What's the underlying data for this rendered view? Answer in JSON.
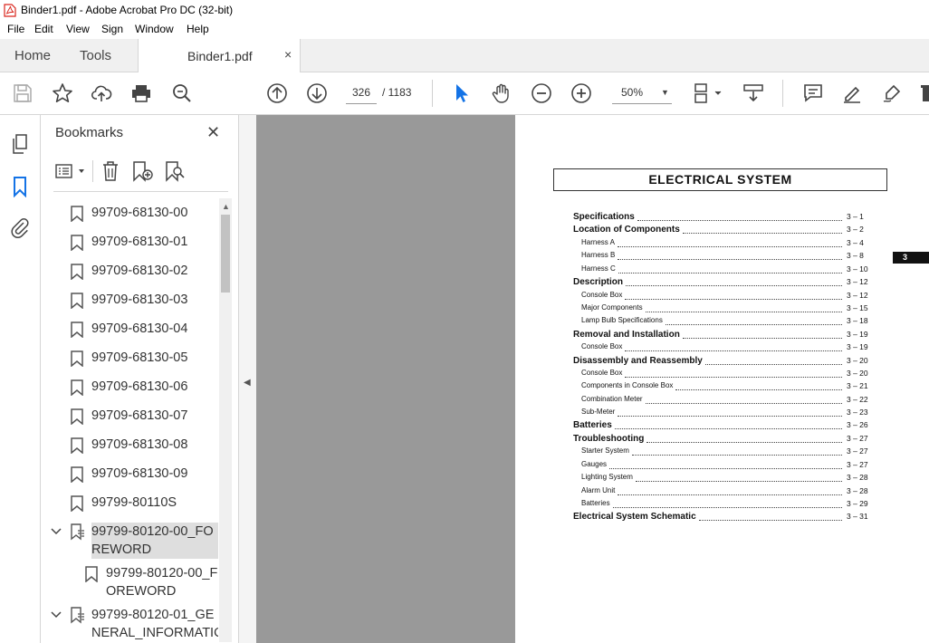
{
  "window": {
    "title": "Binder1.pdf - Adobe Acrobat Pro DC (32-bit)"
  },
  "menu": [
    "File",
    "Edit",
    "View",
    "Sign",
    "Window",
    "Help"
  ],
  "tabs": {
    "home": "Home",
    "tools": "Tools",
    "document": "Binder1.pdf",
    "close": "×"
  },
  "toolbar": {
    "current_page": "326",
    "page_total": "/  1183",
    "zoom": "50%"
  },
  "bookmarks": {
    "title": "Bookmarks",
    "items": [
      {
        "label": "99709-68130-00"
      },
      {
        "label": "99709-68130-01"
      },
      {
        "label": "99709-68130-02"
      },
      {
        "label": "99709-68130-03"
      },
      {
        "label": "99709-68130-04"
      },
      {
        "label": "99709-68130-05"
      },
      {
        "label": "99709-68130-06"
      },
      {
        "label": "99709-68130-07"
      },
      {
        "label": "99709-68130-08"
      },
      {
        "label": "99709-68130-09"
      },
      {
        "label": "99799-80110S"
      },
      {
        "label": "99799-80120-00_FO\nREWORD"
      },
      {
        "label": "99799-80120-00_F\nOREWORD"
      },
      {
        "label": "99799-80120-01_GE\nNERAL_INFORMATIO"
      }
    ]
  },
  "document": {
    "heading": "ELECTRICAL  SYSTEM",
    "section_tab": "3",
    "toc": [
      {
        "text": "Specifications",
        "page": "3 –   1"
      },
      {
        "text": "Location of Components",
        "page": "3 –   2"
      },
      {
        "text": "Harness A",
        "page": "3 –   4"
      },
      {
        "text": "Harness B",
        "page": "3 –   8"
      },
      {
        "text": "Harness C",
        "page": "3 – 10"
      },
      {
        "text": "Description",
        "page": "3 – 12"
      },
      {
        "text": "Console Box",
        "page": "3 – 12"
      },
      {
        "text": "Major Components",
        "page": "3 – 15"
      },
      {
        "text": "Lamp Bulb Specifications",
        "page": "3 – 18"
      },
      {
        "text": "Removal and Installation",
        "page": "3 – 19"
      },
      {
        "text": "Console Box",
        "page": "3 – 19"
      },
      {
        "text": "Disassembly and Reassembly",
        "page": "3 – 20"
      },
      {
        "text": "Console Box",
        "page": "3 – 20"
      },
      {
        "text": "Components in Console Box",
        "page": "3 – 21"
      },
      {
        "text": "Combination Meter",
        "page": "3 – 22"
      },
      {
        "text": "Sub-Meter",
        "page": "3 – 23"
      },
      {
        "text": "Batteries",
        "page": "3 – 26"
      },
      {
        "text": "Troubleshooting",
        "page": "3 – 27"
      },
      {
        "text": "Starter System",
        "page": "3 – 27"
      },
      {
        "text": "Gauges",
        "page": "3 – 27"
      },
      {
        "text": "Lighting System",
        "page": "3 – 28"
      },
      {
        "text": "Alarm Unit",
        "page": "3 – 28"
      },
      {
        "text": "Batteries",
        "page": "3 – 29"
      },
      {
        "text": "Electrical System Schematic",
        "page": "3 – 31"
      }
    ]
  }
}
